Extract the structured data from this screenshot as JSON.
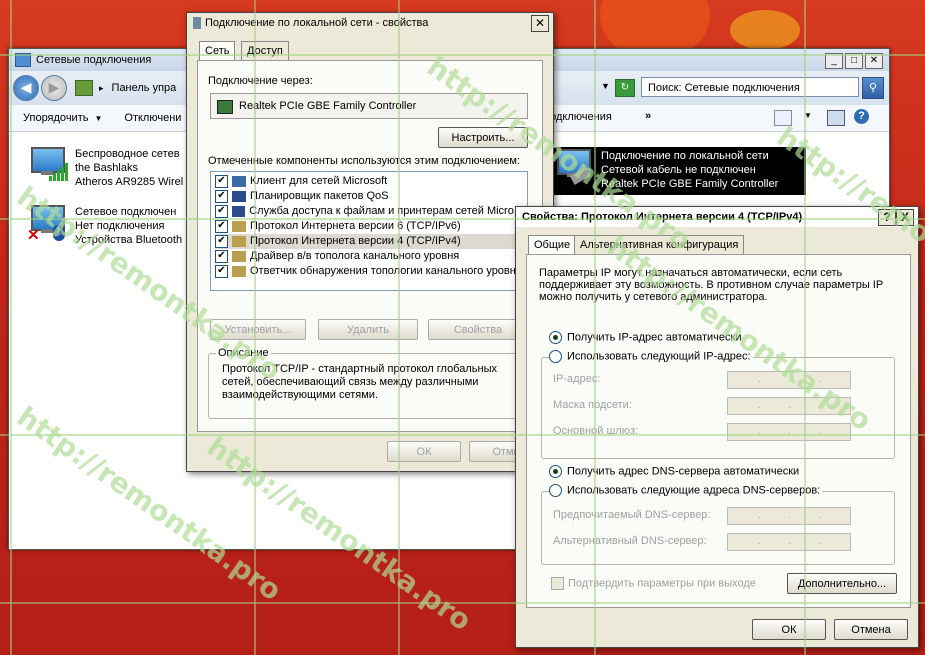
{
  "explorer": {
    "title": "Сетевые подключения",
    "address": "Панель упра",
    "search_placeholder": "Поиск: Сетевые подключения",
    "toolbar": {
      "organize": "Упорядочить",
      "disable": "Отключени",
      "rename": "е подключения",
      "more": "»"
    },
    "connections": [
      {
        "name": "Беспроводное сетев",
        "status": "the Bashlaks",
        "device": "Atheros AR9285 Wirel"
      },
      {
        "name": "Сетевое подключен",
        "status": "Нет подключения",
        "device": "Устройства Bluetooth"
      },
      {
        "name": "Подключение по локальной сети",
        "status": "Сетевой кабель не подключен",
        "device": "Realtek PCIe GBE Family Controller"
      }
    ]
  },
  "lan_dialog": {
    "title": "Подключение по локальной сети - свойства",
    "tabs": [
      "Сеть",
      "Доступ"
    ],
    "connect_using_label": "Подключение через:",
    "adapter": "Realtek PCIe GBE Family Controller",
    "configure_button": "Настроить...",
    "components_label": "Отмеченные компоненты используются этим подключением:",
    "components": [
      "Клиент для сетей Microsoft",
      "Планировщик пакетов QoS",
      "Служба доступа к файлам и принтерам сетей Micro...",
      "Протокол Интернета версии 6 (TCP/IPv6)",
      "Протокол Интернета версии 4 (TCP/IPv4)",
      "Драйвер в/в тополога канального уровня",
      "Ответчик обнаружения топологии канального уровн"
    ],
    "install_button": "Установить...",
    "remove_button": "Удалить",
    "properties_button": "Свойства",
    "description_label": "Описание",
    "description": "Протокол TCP/IP - стандартный протокол глобальных сетей, обеспечивающий связь между различными взаимодействующими сетями.",
    "ok_button": "ОК",
    "cancel_button": "Отме"
  },
  "ipv4_dialog": {
    "title": "Свойства: Протокол Интернета версии 4 (TCP/IPv4)",
    "help": "?",
    "close": "X",
    "tabs": [
      "Общие",
      "Альтернативная конфигурация"
    ],
    "intro": "Параметры IP могут назначаться автоматически, если сеть поддерживает эту возможность. В противном случае параметры IP можно получить у сетевого администратора.",
    "auto_ip": "Получить IP-адрес автоматически",
    "manual_ip": "Использовать следующий IP-адрес:",
    "ip_address": "IP-адрес:",
    "subnet": "Маска подсети:",
    "gateway": "Основной шлюз:",
    "auto_dns": "Получить адрес DNS-сервера автоматически",
    "manual_dns": "Использовать следующие адреса DNS-серверов:",
    "preferred_dns": "Предпочитаемый DNS-сервер:",
    "alternate_dns": "Альтернативный DNS-сервер:",
    "validate": "Подтвердить параметры при выходе",
    "advanced_button": "Дополнительно...",
    "ok_button": "ОК",
    "cancel_button": "Отмена"
  },
  "watermark": "http://remontka.pro",
  "colors": {
    "background": "#c2261a",
    "accent": "#2e6bb5",
    "dialog": "#ece9d8"
  }
}
